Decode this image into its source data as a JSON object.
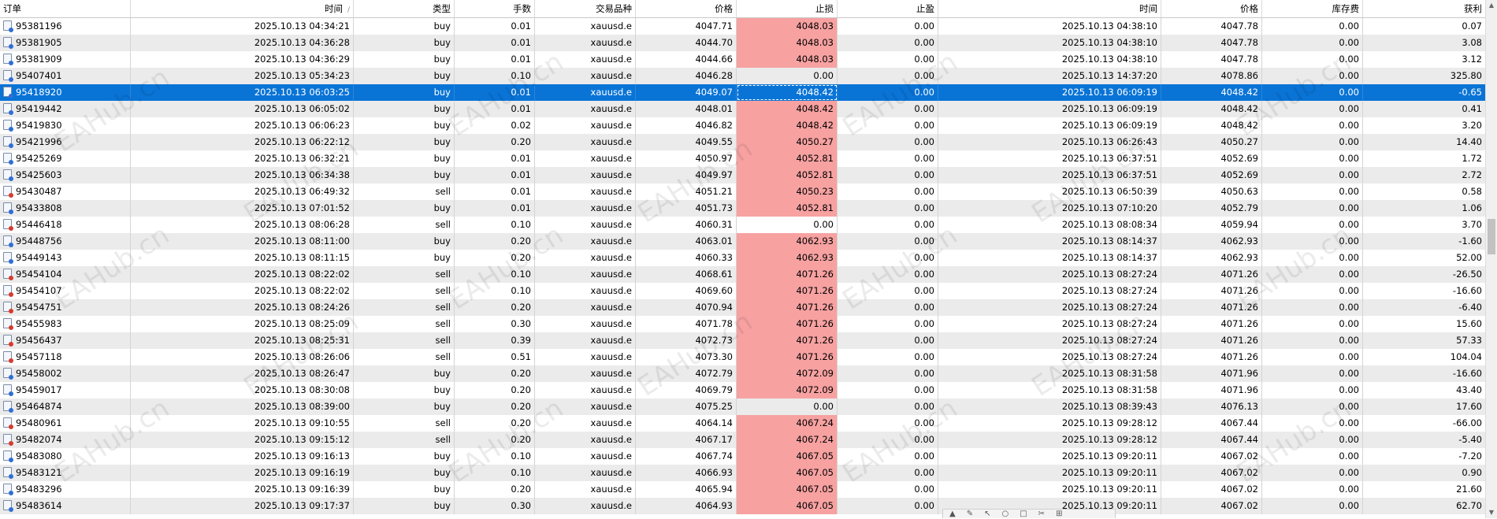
{
  "columns": [
    {
      "key": "order",
      "label": "订单",
      "width": 166,
      "align": "l"
    },
    {
      "key": "open_time",
      "label": "时间",
      "width": 283,
      "align": "r",
      "sort": "/"
    },
    {
      "key": "type",
      "label": "类型",
      "width": 128,
      "align": "r"
    },
    {
      "key": "volume",
      "label": "手数",
      "width": 102,
      "align": "r"
    },
    {
      "key": "symbol",
      "label": "交易品种",
      "width": 128,
      "align": "r"
    },
    {
      "key": "open_price",
      "label": "价格",
      "width": 128,
      "align": "r"
    },
    {
      "key": "sl",
      "label": "止损",
      "width": 128,
      "align": "r"
    },
    {
      "key": "tp",
      "label": "止盈",
      "width": 128,
      "align": "r"
    },
    {
      "key": "close_time",
      "label": "时间",
      "width": 283,
      "align": "r"
    },
    {
      "key": "close_price",
      "label": "价格",
      "width": 128,
      "align": "r"
    },
    {
      "key": "swap",
      "label": "库存费",
      "width": 128,
      "align": "r"
    },
    {
      "key": "profit",
      "label": "获利",
      "width": 156,
      "align": "r"
    }
  ],
  "rows": [
    [
      "95381196",
      "2025.10.13 04:34:21",
      "buy",
      "0.01",
      "xauusd.e",
      "4047.71",
      "4048.03",
      "0.00",
      "2025.10.13 04:38:10",
      "4047.78",
      "0.00",
      "0.07"
    ],
    [
      "95381905",
      "2025.10.13 04:36:28",
      "buy",
      "0.01",
      "xauusd.e",
      "4044.70",
      "4048.03",
      "0.00",
      "2025.10.13 04:38:10",
      "4047.78",
      "0.00",
      "3.08"
    ],
    [
      "95381909",
      "2025.10.13 04:36:29",
      "buy",
      "0.01",
      "xauusd.e",
      "4044.66",
      "4048.03",
      "0.00",
      "2025.10.13 04:38:10",
      "4047.78",
      "0.00",
      "3.12"
    ],
    [
      "95407401",
      "2025.10.13 05:34:23",
      "buy",
      "0.10",
      "xauusd.e",
      "4046.28",
      "0.00",
      "0.00",
      "2025.10.13 14:37:20",
      "4078.86",
      "0.00",
      "325.80"
    ],
    [
      "95418920",
      "2025.10.13 06:03:25",
      "buy",
      "0.01",
      "xauusd.e",
      "4049.07",
      "4048.42",
      "0.00",
      "2025.10.13 06:09:19",
      "4048.42",
      "0.00",
      "-0.65"
    ],
    [
      "95419442",
      "2025.10.13 06:05:02",
      "buy",
      "0.01",
      "xauusd.e",
      "4048.01",
      "4048.42",
      "0.00",
      "2025.10.13 06:09:19",
      "4048.42",
      "0.00",
      "0.41"
    ],
    [
      "95419830",
      "2025.10.13 06:06:23",
      "buy",
      "0.02",
      "xauusd.e",
      "4046.82",
      "4048.42",
      "0.00",
      "2025.10.13 06:09:19",
      "4048.42",
      "0.00",
      "3.20"
    ],
    [
      "95421996",
      "2025.10.13 06:22:12",
      "buy",
      "0.20",
      "xauusd.e",
      "4049.55",
      "4050.27",
      "0.00",
      "2025.10.13 06:26:43",
      "4050.27",
      "0.00",
      "14.40"
    ],
    [
      "95425269",
      "2025.10.13 06:32:21",
      "buy",
      "0.01",
      "xauusd.e",
      "4050.97",
      "4052.81",
      "0.00",
      "2025.10.13 06:37:51",
      "4052.69",
      "0.00",
      "1.72"
    ],
    [
      "95425603",
      "2025.10.13 06:34:38",
      "buy",
      "0.01",
      "xauusd.e",
      "4049.97",
      "4052.81",
      "0.00",
      "2025.10.13 06:37:51",
      "4052.69",
      "0.00",
      "2.72"
    ],
    [
      "95430487",
      "2025.10.13 06:49:32",
      "sell",
      "0.01",
      "xauusd.e",
      "4051.21",
      "4050.23",
      "0.00",
      "2025.10.13 06:50:39",
      "4050.63",
      "0.00",
      "0.58"
    ],
    [
      "95433808",
      "2025.10.13 07:01:52",
      "buy",
      "0.01",
      "xauusd.e",
      "4051.73",
      "4052.81",
      "0.00",
      "2025.10.13 07:10:20",
      "4052.79",
      "0.00",
      "1.06"
    ],
    [
      "95446418",
      "2025.10.13 08:06:28",
      "sell",
      "0.10",
      "xauusd.e",
      "4060.31",
      "0.00",
      "0.00",
      "2025.10.13 08:08:34",
      "4059.94",
      "0.00",
      "3.70"
    ],
    [
      "95448756",
      "2025.10.13 08:11:00",
      "buy",
      "0.20",
      "xauusd.e",
      "4063.01",
      "4062.93",
      "0.00",
      "2025.10.13 08:14:37",
      "4062.93",
      "0.00",
      "-1.60"
    ],
    [
      "95449143",
      "2025.10.13 08:11:15",
      "buy",
      "0.20",
      "xauusd.e",
      "4060.33",
      "4062.93",
      "0.00",
      "2025.10.13 08:14:37",
      "4062.93",
      "0.00",
      "52.00"
    ],
    [
      "95454104",
      "2025.10.13 08:22:02",
      "sell",
      "0.10",
      "xauusd.e",
      "4068.61",
      "4071.26",
      "0.00",
      "2025.10.13 08:27:24",
      "4071.26",
      "0.00",
      "-26.50"
    ],
    [
      "95454107",
      "2025.10.13 08:22:02",
      "sell",
      "0.10",
      "xauusd.e",
      "4069.60",
      "4071.26",
      "0.00",
      "2025.10.13 08:27:24",
      "4071.26",
      "0.00",
      "-16.60"
    ],
    [
      "95454751",
      "2025.10.13 08:24:26",
      "sell",
      "0.20",
      "xauusd.e",
      "4070.94",
      "4071.26",
      "0.00",
      "2025.10.13 08:27:24",
      "4071.26",
      "0.00",
      "-6.40"
    ],
    [
      "95455983",
      "2025.10.13 08:25:09",
      "sell",
      "0.30",
      "xauusd.e",
      "4071.78",
      "4071.26",
      "0.00",
      "2025.10.13 08:27:24",
      "4071.26",
      "0.00",
      "15.60"
    ],
    [
      "95456437",
      "2025.10.13 08:25:31",
      "sell",
      "0.39",
      "xauusd.e",
      "4072.73",
      "4071.26",
      "0.00",
      "2025.10.13 08:27:24",
      "4071.26",
      "0.00",
      "57.33"
    ],
    [
      "95457118",
      "2025.10.13 08:26:06",
      "sell",
      "0.51",
      "xauusd.e",
      "4073.30",
      "4071.26",
      "0.00",
      "2025.10.13 08:27:24",
      "4071.26",
      "0.00",
      "104.04"
    ],
    [
      "95458002",
      "2025.10.13 08:26:47",
      "buy",
      "0.20",
      "xauusd.e",
      "4072.79",
      "4072.09",
      "0.00",
      "2025.10.13 08:31:58",
      "4071.96",
      "0.00",
      "-16.60"
    ],
    [
      "95459017",
      "2025.10.13 08:30:08",
      "buy",
      "0.20",
      "xauusd.e",
      "4069.79",
      "4072.09",
      "0.00",
      "2025.10.13 08:31:58",
      "4071.96",
      "0.00",
      "43.40"
    ],
    [
      "95464874",
      "2025.10.13 08:39:00",
      "buy",
      "0.20",
      "xauusd.e",
      "4075.25",
      "0.00",
      "0.00",
      "2025.10.13 08:39:43",
      "4076.13",
      "0.00",
      "17.60"
    ],
    [
      "95480961",
      "2025.10.13 09:10:55",
      "sell",
      "0.20",
      "xauusd.e",
      "4064.14",
      "4067.24",
      "0.00",
      "2025.10.13 09:28:12",
      "4067.44",
      "0.00",
      "-66.00"
    ],
    [
      "95482074",
      "2025.10.13 09:15:12",
      "sell",
      "0.20",
      "xauusd.e",
      "4067.17",
      "4067.24",
      "0.00",
      "2025.10.13 09:28:12",
      "4067.44",
      "0.00",
      "-5.40"
    ],
    [
      "95483080",
      "2025.10.13 09:16:13",
      "buy",
      "0.10",
      "xauusd.e",
      "4067.74",
      "4067.05",
      "0.00",
      "2025.10.13 09:20:11",
      "4067.02",
      "0.00",
      "-7.20"
    ],
    [
      "95483121",
      "2025.10.13 09:16:19",
      "buy",
      "0.10",
      "xauusd.e",
      "4066.93",
      "4067.05",
      "0.00",
      "2025.10.13 09:20:11",
      "4067.02",
      "0.00",
      "0.90"
    ],
    [
      "95483296",
      "2025.10.13 09:16:39",
      "buy",
      "0.20",
      "xauusd.e",
      "4065.94",
      "4067.05",
      "0.00",
      "2025.10.13 09:20:11",
      "4067.02",
      "0.00",
      "21.60"
    ],
    [
      "95483614",
      "2025.10.13 09:17:37",
      "buy",
      "0.30",
      "xauusd.e",
      "4064.93",
      "4067.05",
      "0.00",
      "2025.10.13 09:20:11",
      "4067.02",
      "0.00",
      "62.70"
    ]
  ],
  "selected_row_index": 4,
  "watermark_text": "EAHub.cn",
  "colors": {
    "selection": "#0a74d6",
    "stop_loss_highlight": "#f7a1a1",
    "row_alt": "#ebebeb"
  }
}
